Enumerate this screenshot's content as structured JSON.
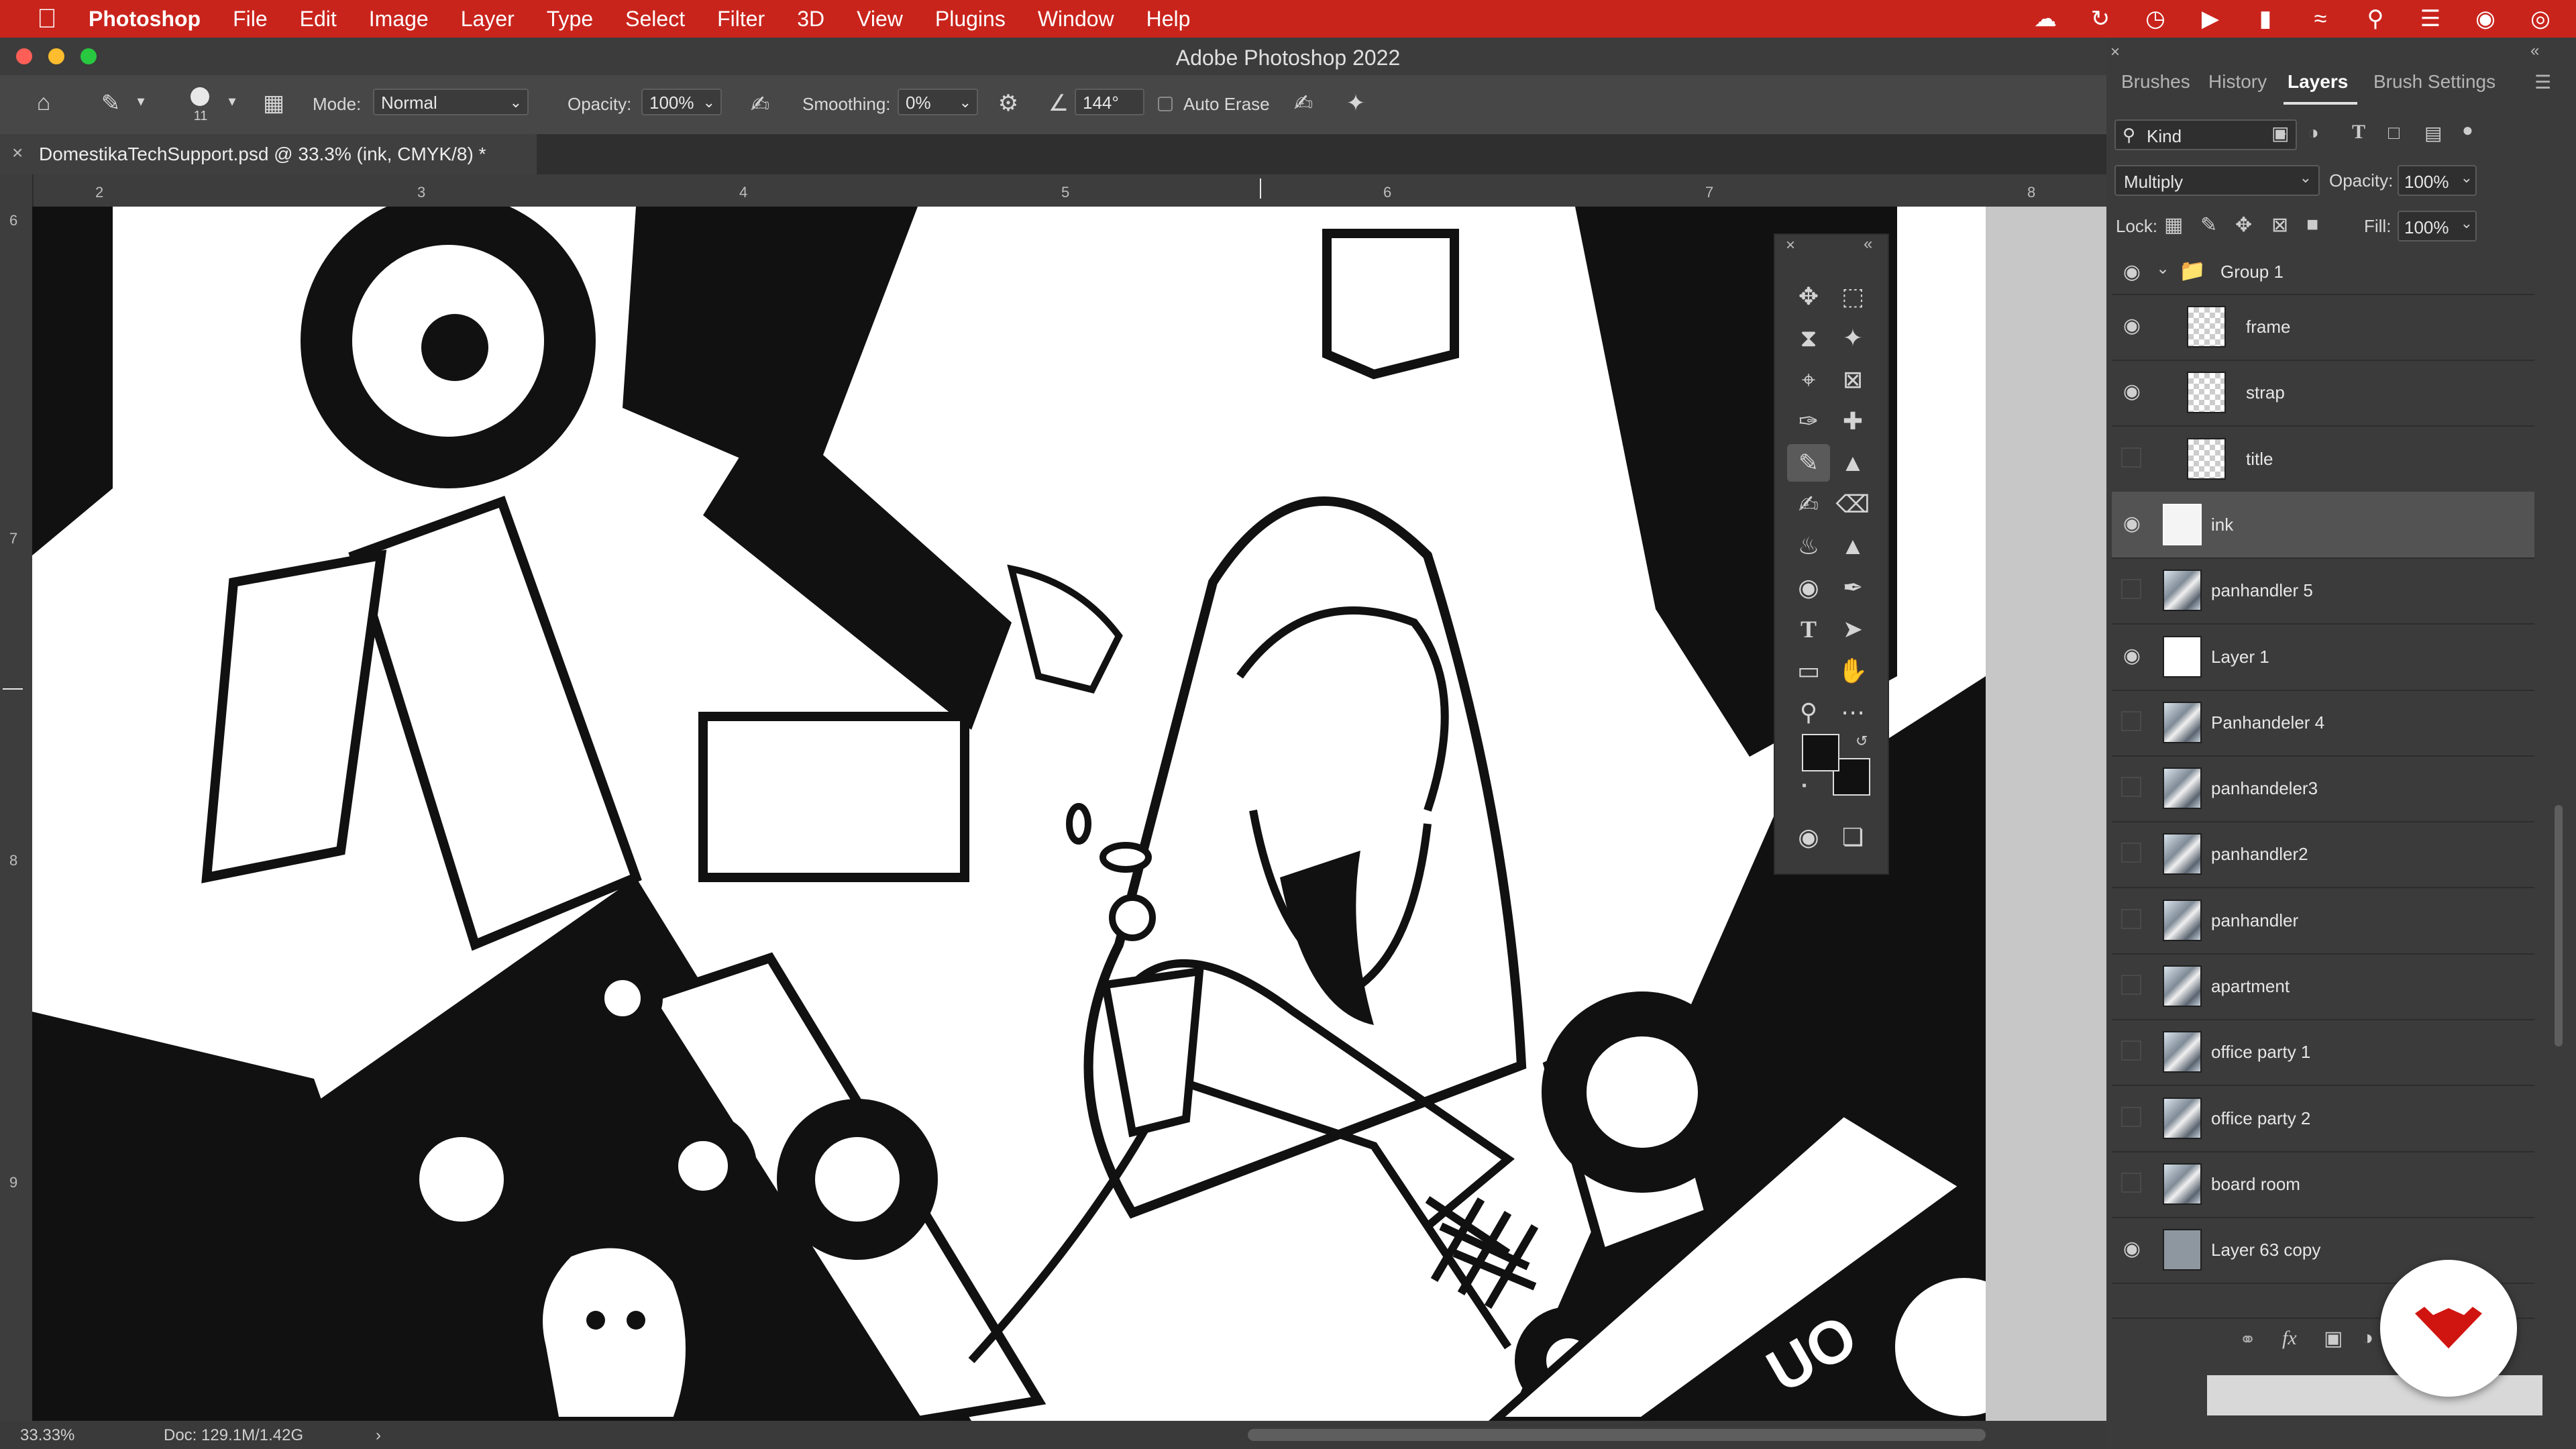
{
  "menubar": {
    "app": "Photoshop",
    "items": [
      "File",
      "Edit",
      "Image",
      "Layer",
      "Type",
      "Select",
      "Filter",
      "3D",
      "View",
      "Plugins",
      "Window",
      "Help"
    ]
  },
  "window": {
    "title": "Adobe Photoshop 2022"
  },
  "options": {
    "brush_size": "11",
    "mode_label": "Mode:",
    "mode_value": "Normal",
    "opacity_label": "Opacity:",
    "opacity_value": "100%",
    "smoothing_label": "Smoothing:",
    "smoothing_value": "0%",
    "angle_value": "144°",
    "auto_erase_label": "Auto Erase"
  },
  "document": {
    "tab_title": "DomestikaTechSupport.psd @ 33.3% (ink, CMYK/8) *",
    "ruler_top": [
      "2",
      "3",
      "4",
      "5",
      "6",
      "7",
      "8"
    ],
    "ruler_left": [
      "6",
      "7",
      "8",
      "9"
    ]
  },
  "status": {
    "zoom": "33.33%",
    "doc": "Doc: 129.1M/1.42G"
  },
  "panel": {
    "tabs": [
      "Brushes",
      "History",
      "Layers",
      "Brush Settings"
    ],
    "active_tab": "Layers",
    "filter_label": "Kind",
    "blend_mode": "Multiply",
    "opacity_label": "Opacity:",
    "opacity_value": "100%",
    "lock_label": "Lock:",
    "fill_label": "Fill:",
    "fill_value": "100%",
    "group_name": "Group 1",
    "layers": [
      {
        "name": "frame",
        "visible": true,
        "thumb": "checker",
        "indent": true
      },
      {
        "name": "strap",
        "visible": true,
        "thumb": "checker",
        "indent": true
      },
      {
        "name": "title",
        "visible": false,
        "thumb": "checker",
        "indent": true
      },
      {
        "name": "ink",
        "visible": true,
        "thumb": "ink",
        "indent": false,
        "selected": true
      },
      {
        "name": "panhandler 5",
        "visible": false,
        "thumb": "art",
        "indent": false
      },
      {
        "name": "Layer 1",
        "visible": true,
        "thumb": "white",
        "indent": false
      },
      {
        "name": "Panhandeler 4",
        "visible": false,
        "thumb": "art",
        "indent": false
      },
      {
        "name": "panhandeler3",
        "visible": false,
        "thumb": "art",
        "indent": false
      },
      {
        "name": "panhandler2",
        "visible": false,
        "thumb": "art",
        "indent": false
      },
      {
        "name": "panhandler",
        "visible": false,
        "thumb": "art",
        "indent": false
      },
      {
        "name": "apartment",
        "visible": false,
        "thumb": "art",
        "indent": false
      },
      {
        "name": "office party  1",
        "visible": false,
        "thumb": "art",
        "indent": false
      },
      {
        "name": "office party 2",
        "visible": false,
        "thumb": "art",
        "indent": false
      },
      {
        "name": "board room",
        "visible": false,
        "thumb": "art",
        "indent": false
      },
      {
        "name": "Layer 63 copy",
        "visible": true,
        "thumb": "gray",
        "indent": false
      }
    ]
  },
  "colors": {
    "menubar": "#c9241c",
    "selected_row": "#535353",
    "badge_logo": "#d0140f"
  }
}
